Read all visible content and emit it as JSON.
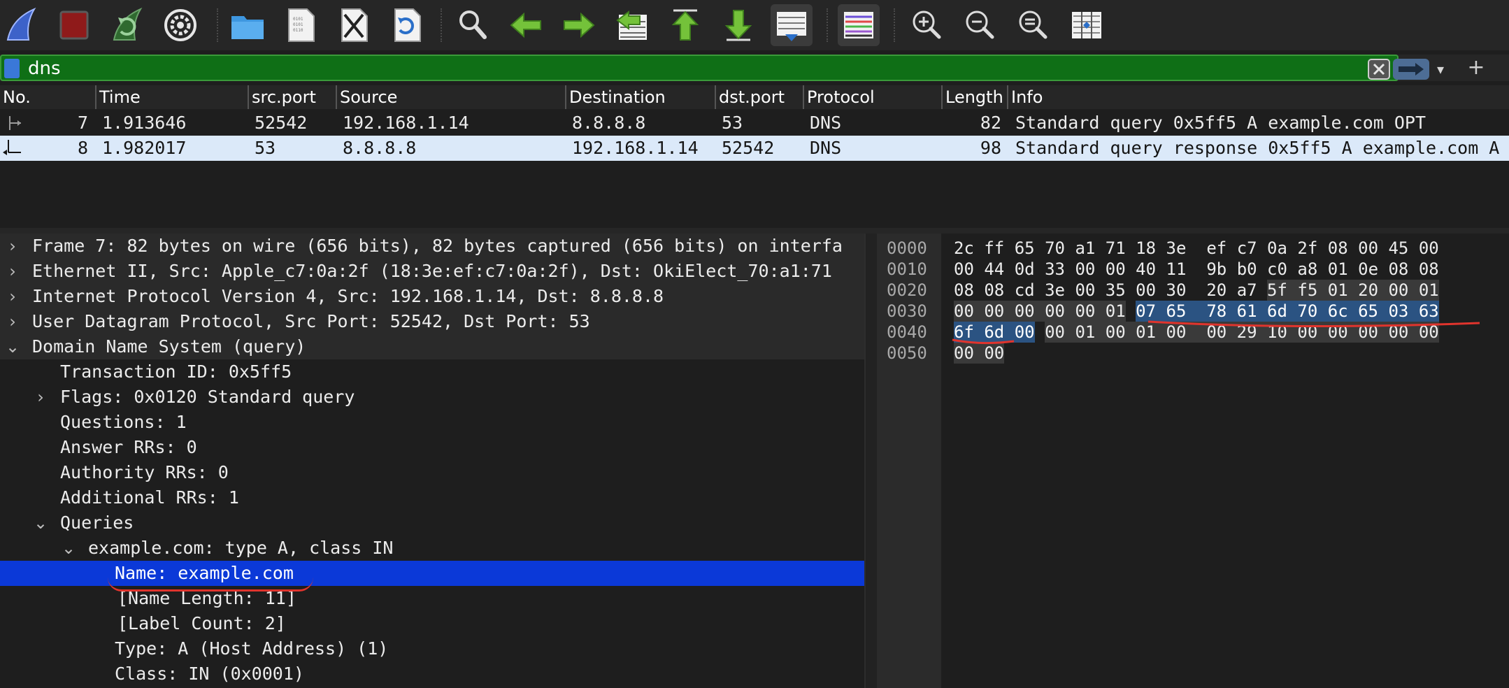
{
  "filter": {
    "text": "dns",
    "dropdown_glyph": "▾",
    "add_glyph": "+"
  },
  "packet_list": {
    "columns": [
      "No.",
      "Time",
      "src.port",
      "Source",
      "Destination",
      "dst.port",
      "Protocol",
      "Length",
      "Info"
    ],
    "rows": [
      {
        "no": "7",
        "time": "1.913646",
        "src_port": "52542",
        "source": "192.168.1.14",
        "destination": "8.8.8.8",
        "dst_port": "53",
        "protocol": "DNS",
        "length": "82",
        "info": "Standard query 0x5ff5 A example.com OPT",
        "selected": false
      },
      {
        "no": "8",
        "time": "1.982017",
        "src_port": "53",
        "source": "8.8.8.8",
        "destination": "192.168.1.14",
        "dst_port": "52542",
        "protocol": "DNS",
        "length": "98",
        "info": "Standard query response 0x5ff5 A example.com A",
        "selected": true
      }
    ]
  },
  "details": {
    "rows": [
      {
        "text": "Frame 7: 82 bytes on wire (656 bits), 82 bytes captured (656 bits) on interfa",
        "expander": ">"
      },
      {
        "text": "Ethernet II, Src: Apple_c7:0a:2f (18:3e:ef:c7:0a:2f), Dst: OkiElect_70:a1:71",
        "expander": ">"
      },
      {
        "text": "Internet Protocol Version 4, Src: 192.168.1.14, Dst: 8.8.8.8",
        "expander": ">"
      },
      {
        "text": "User Datagram Protocol, Src Port: 52542, Dst Port: 53",
        "expander": ">"
      },
      {
        "text": "Domain Name System (query)",
        "expander": "v"
      },
      {
        "text": "Transaction ID: 0x5ff5",
        "expander": ""
      },
      {
        "text": "Flags: 0x0120 Standard query",
        "expander": ">"
      },
      {
        "text": "Questions: 1",
        "expander": ""
      },
      {
        "text": "Answer RRs: 0",
        "expander": ""
      },
      {
        "text": "Authority RRs: 0",
        "expander": ""
      },
      {
        "text": "Additional RRs: 1",
        "expander": ""
      },
      {
        "text": "Queries",
        "expander": "v"
      },
      {
        "text": "example.com: type A, class IN",
        "expander": "v"
      },
      {
        "text": "Name: example.com",
        "expander": ""
      },
      {
        "text": "[Name Length: 11]",
        "expander": ""
      },
      {
        "text": "[Label Count: 2]",
        "expander": ""
      },
      {
        "text": "Type: A (Host Address) (1)",
        "expander": ""
      },
      {
        "text": "Class: IN (0x0001)",
        "expander": ""
      }
    ]
  },
  "bytes": {
    "lines": [
      {
        "offset": "0000",
        "a": "2c ff 65 70 a1 71 18 3e",
        "b": "ef c7 0a 2f 08 00 45 00"
      },
      {
        "offset": "0010",
        "a": "00 44 0d 33 00 00 40 11",
        "b": "9b b0 c0 a8 01 0e 08 08"
      },
      {
        "offset": "0020",
        "a": "08 08 cd 3e 00 35 00 30",
        "b": "20 a7 5f f5 01 20 00 01"
      },
      {
        "offset": "0030",
        "a": "00 00 00 00 00 01 07 65",
        "b": "78 61 6d 70 6c 65 03 63"
      },
      {
        "offset": "0040",
        "a": "6f 6d 00 00 01 00 01 00",
        "b": "00 29 10 00 00 00 00 00"
      },
      {
        "offset": "0050",
        "a": "00 00",
        "b": ""
      }
    ]
  },
  "colors": {
    "filter_bg": "#0f6f16",
    "selected_packet_bg": "#dbe9f9",
    "selected_detail_bg": "#0b39d8",
    "hex_highlight": "#2b5382",
    "annotation_red": "#e0342d"
  },
  "icons": [
    "shark-fin-icon",
    "stop-capture-icon",
    "restart-capture-icon",
    "capture-options-icon",
    "open-file-icon",
    "save-file-icon",
    "close-file-icon",
    "reload-file-icon",
    "find-packet-icon",
    "go-back-icon",
    "go-forward-icon",
    "go-to-packet-icon",
    "first-packet-icon",
    "last-packet-icon",
    "autoscroll-icon",
    "colorize-icon",
    "zoom-in-icon",
    "zoom-out-icon",
    "normal-size-icon",
    "resize-columns-icon"
  ]
}
